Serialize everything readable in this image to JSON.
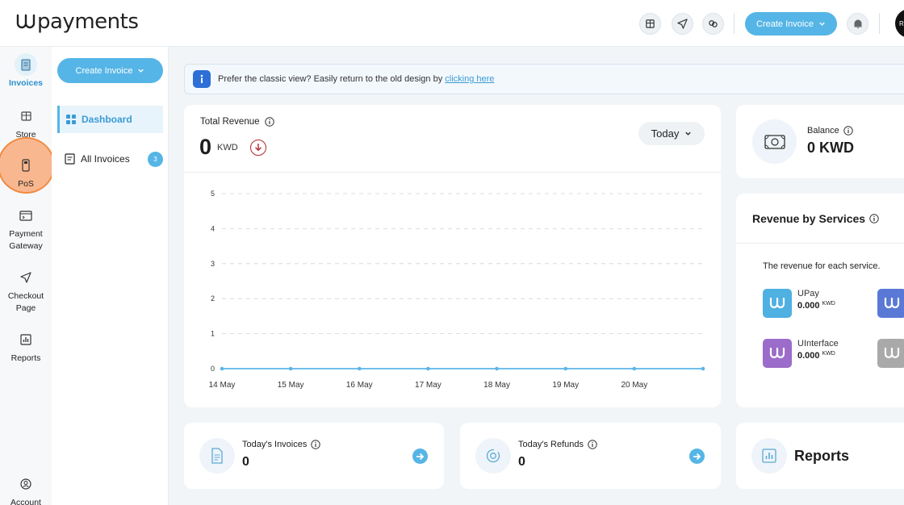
{
  "brand": {
    "logo_text": "payments"
  },
  "topbar": {
    "create_label": "Create Invoice",
    "avatar_initials": "R U"
  },
  "rail": {
    "invoices": "Invoices",
    "store": "Store",
    "pos": "PoS",
    "payment_gateway_1": "Payment",
    "payment_gateway_2": "Gateway",
    "checkout_1": "Checkout",
    "checkout_2": "Page",
    "reports": "Reports",
    "account": "Account"
  },
  "sidebar": {
    "create_label": "Create Invoice",
    "dashboard": "Dashboard",
    "all_invoices": "All Invoices",
    "all_invoices_count": "3"
  },
  "banner": {
    "text": "Prefer the classic view? Easily return to the old design by ",
    "link": "clicking here"
  },
  "revenue": {
    "title": "Total Revenue",
    "value": "0",
    "currency": "KWD",
    "period": "Today"
  },
  "chart_data": {
    "type": "line",
    "x": [
      "14 May",
      "15 May",
      "16 May",
      "17 May",
      "18 May",
      "19 May",
      "20 May",
      ""
    ],
    "series": [
      {
        "values": [
          0,
          0,
          0,
          0,
          0,
          0,
          0,
          0
        ]
      }
    ],
    "yticks": [
      "0",
      "1",
      "2",
      "3",
      "4",
      "5"
    ],
    "ylim": [
      0,
      5
    ],
    "grid": true,
    "color": "#5bb6e4"
  },
  "balance": {
    "label": "Balance",
    "value": "0 KWD"
  },
  "services": {
    "title": "Revenue by Services",
    "subtitle": "The revenue for each service.",
    "items": [
      {
        "name": "UPay",
        "amount": "0.000",
        "currency": "KWD",
        "color": "#4fb0e2"
      },
      {
        "name": "UInterface",
        "amount": "0.000",
        "currency": "KWD",
        "color": "#9b6cc9"
      },
      {
        "name": "",
        "amount": "",
        "currency": "",
        "color": "#5a79d6"
      },
      {
        "name": "",
        "amount": "",
        "currency": "",
        "color": "#a9a9a9"
      }
    ]
  },
  "today_invoices": {
    "label": "Today's Invoices",
    "value": "0"
  },
  "today_refunds": {
    "label": "Today's Refunds",
    "value": "0"
  },
  "reports": {
    "label": "Reports"
  },
  "colors": {
    "accent": "#55b5e6",
    "highlight": "#f9b78f",
    "negative": "#b3262e"
  }
}
